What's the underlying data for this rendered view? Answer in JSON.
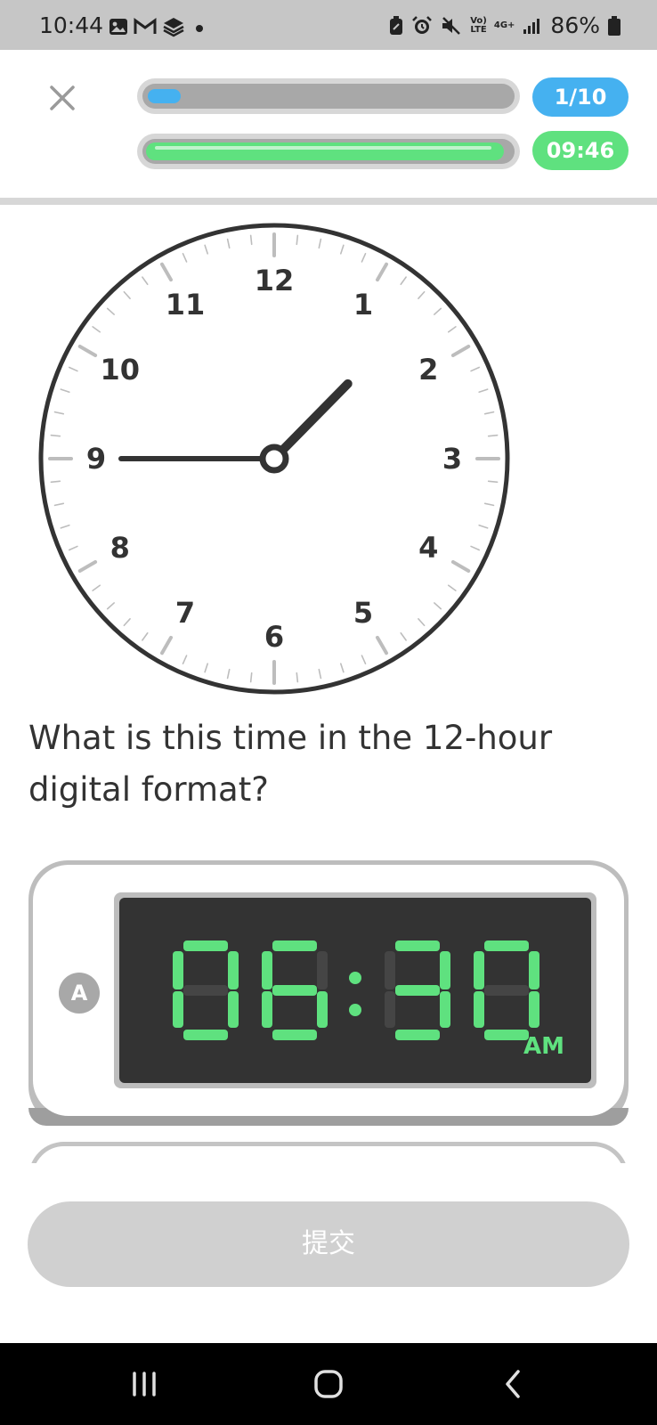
{
  "status_bar": {
    "time": "10:44",
    "battery_percent": "86%",
    "network_volte": "Vo)\nLTE",
    "network_type": "4G+",
    "left_icons": [
      "gallery-icon",
      "gmail-icon",
      "stack-icon",
      "dot-icon"
    ],
    "right_icons": [
      "battery-saver-icon",
      "alarm-icon",
      "mute-icon",
      "signal-icon",
      "battery-icon"
    ]
  },
  "header": {
    "close_icon": "close-icon",
    "question_counter": "1/10",
    "progress_fraction": 0.1,
    "timer": "09:46",
    "timer_fraction": 0.98,
    "colors": {
      "progress": "#45b1f0",
      "timer": "#5fe17f"
    }
  },
  "clock": {
    "numbers": [
      "12",
      "1",
      "2",
      "3",
      "4",
      "5",
      "6",
      "7",
      "8",
      "9",
      "10",
      "11"
    ],
    "hour": 0,
    "minute": 45,
    "hand_positions": {
      "hour_hand_points_to": 0.75,
      "minute_hand_points_to": 9
    }
  },
  "question": {
    "text": "What is this time in the 12-hour digital format?"
  },
  "options": [
    {
      "badge": "A",
      "time": "06:30",
      "meridiem": "AM",
      "lcd_color": "#5fe17f"
    }
  ],
  "submit": {
    "label": "提交",
    "enabled": false
  },
  "nav_bar": {
    "icons": [
      "recents-icon",
      "home-icon",
      "back-icon"
    ]
  }
}
